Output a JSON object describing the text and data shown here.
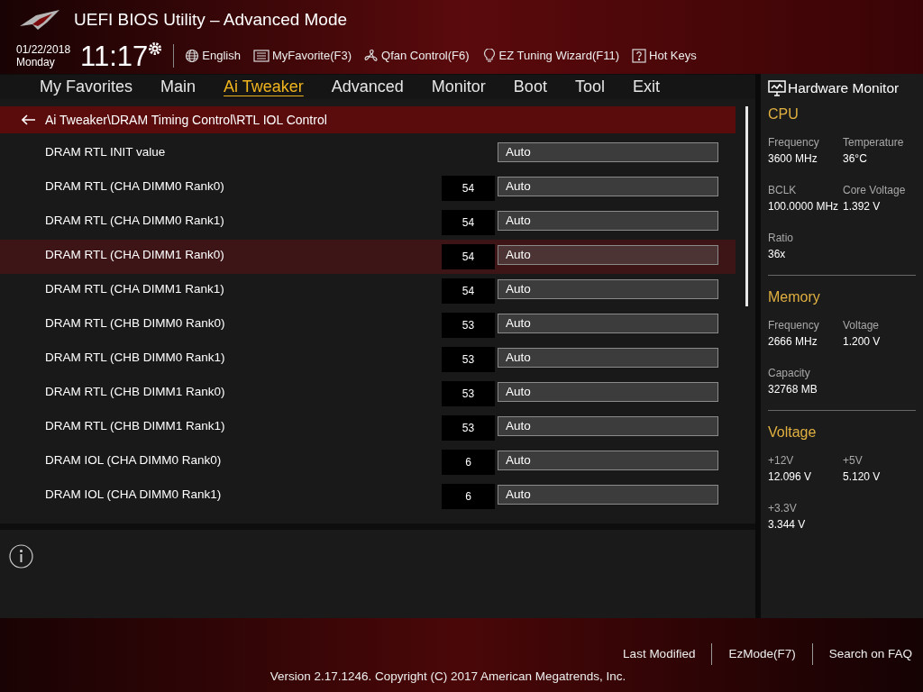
{
  "window": {
    "title": "UEFI BIOS Utility – Advanced Mode"
  },
  "status": {
    "date": "01/22/2018",
    "day": "Monday",
    "time": "11:17"
  },
  "toolbar": [
    {
      "kind": "language",
      "label": "English"
    },
    {
      "kind": "favorite",
      "label": "MyFavorite(F3)"
    },
    {
      "kind": "fan",
      "label": "Qfan Control(F6)"
    },
    {
      "kind": "bulb",
      "label": "EZ Tuning Wizard(F11)"
    },
    {
      "kind": "help",
      "label": "Hot Keys"
    }
  ],
  "tabs": [
    {
      "label": "My Favorites",
      "selected": false
    },
    {
      "label": "Main",
      "selected": false
    },
    {
      "label": "Ai Tweaker",
      "selected": true
    },
    {
      "label": "Advanced",
      "selected": false
    },
    {
      "label": "Monitor",
      "selected": false
    },
    {
      "label": "Boot",
      "selected": false
    },
    {
      "label": "Tool",
      "selected": false
    },
    {
      "label": "Exit",
      "selected": false
    }
  ],
  "breadcrumb": "Ai Tweaker\\DRAM Timing Control\\RTL IOL Control",
  "settings": [
    {
      "label": "DRAM RTL INIT value",
      "value": "Auto",
      "selected": false
    },
    {
      "label": "DRAM RTL (CHA DIMM0 Rank0)",
      "current": "54",
      "value": "Auto",
      "selected": false
    },
    {
      "label": "DRAM RTL (CHA DIMM0 Rank1)",
      "current": "54",
      "value": "Auto",
      "selected": false
    },
    {
      "label": "DRAM RTL (CHA DIMM1 Rank0)",
      "current": "54",
      "value": "Auto",
      "selected": true
    },
    {
      "label": "DRAM RTL (CHA DIMM1 Rank1)",
      "current": "54",
      "value": "Auto",
      "selected": false
    },
    {
      "label": "DRAM RTL (CHB DIMM0 Rank0)",
      "current": "53",
      "value": "Auto",
      "selected": false
    },
    {
      "label": "DRAM RTL (CHB DIMM0 Rank1)",
      "current": "53",
      "value": "Auto",
      "selected": false
    },
    {
      "label": "DRAM RTL (CHB DIMM1 Rank0)",
      "current": "53",
      "value": "Auto",
      "selected": false
    },
    {
      "label": "DRAM RTL (CHB DIMM1 Rank1)",
      "current": "53",
      "value": "Auto",
      "selected": false
    },
    {
      "label": "DRAM IOL (CHA DIMM0 Rank0)",
      "current": "6",
      "value": "Auto",
      "selected": false
    },
    {
      "label": "DRAM IOL (CHA DIMM0 Rank1)",
      "current": "6",
      "value": "Auto",
      "selected": false
    }
  ],
  "hardware_monitor": {
    "title": "Hardware Monitor",
    "sections": [
      {
        "title": "CPU",
        "items": [
          {
            "label": "Frequency",
            "value": "3600 MHz"
          },
          {
            "label": "Temperature",
            "value": "36°C"
          },
          {
            "label": "BCLK",
            "value": "100.0000 MHz"
          },
          {
            "label": "Core Voltage",
            "value": "1.392 V"
          },
          {
            "label": "Ratio",
            "value": "36x"
          }
        ]
      },
      {
        "title": "Memory",
        "items": [
          {
            "label": "Frequency",
            "value": "2666 MHz"
          },
          {
            "label": "Voltage",
            "value": "1.200 V"
          },
          {
            "label": "Capacity",
            "value": "32768 MB"
          }
        ]
      },
      {
        "title": "Voltage",
        "items": [
          {
            "label": "+12V",
            "value": "12.096 V"
          },
          {
            "label": "+5V",
            "value": "5.120 V"
          },
          {
            "label": "+3.3V",
            "value": "3.344 V"
          }
        ]
      }
    ]
  },
  "footer": {
    "links": [
      "Last Modified",
      "EzMode(F7)",
      "Search on FAQ"
    ],
    "version": "Version 2.17.1246. Copyright (C) 2017 American Megatrends, Inc."
  }
}
